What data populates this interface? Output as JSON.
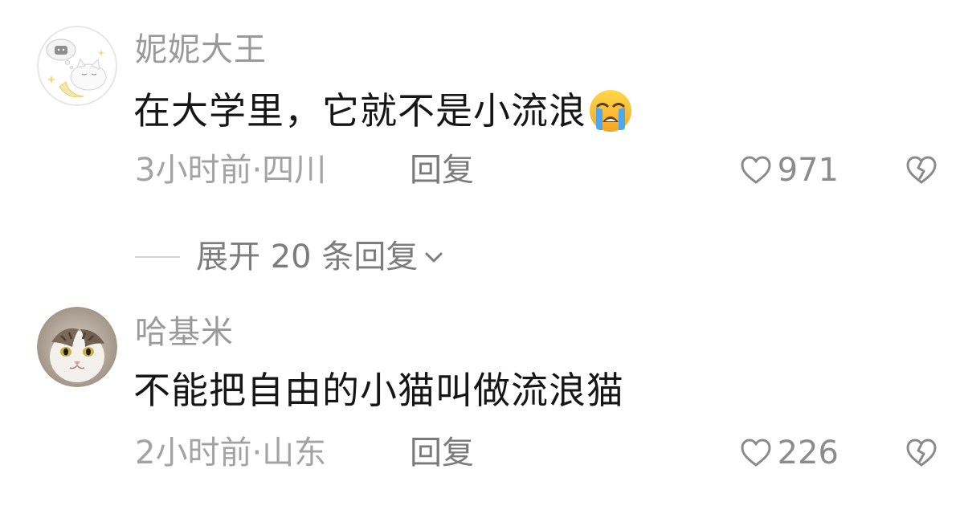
{
  "comments": [
    {
      "username": "妮妮大王",
      "text": "在大学里，它就不是小流浪",
      "emoji": "loudly-crying-face",
      "time_location": "3小时前·四川",
      "reply_label": "回复",
      "likes": "971"
    },
    {
      "username": "哈基米",
      "text": "不能把自由的小猫叫做流浪猫",
      "time_location": "2小时前·山东",
      "reply_label": "回复",
      "likes": "226"
    }
  ],
  "expand_replies": {
    "label": "展开 20 条回复"
  },
  "icons": {
    "like": "heart-outline-icon",
    "dislike": "broken-heart-icon",
    "expand": "chevron-down-icon"
  },
  "colors": {
    "username": "#9a9a9a",
    "text": "#161616",
    "meta": "#a3a3a3"
  }
}
